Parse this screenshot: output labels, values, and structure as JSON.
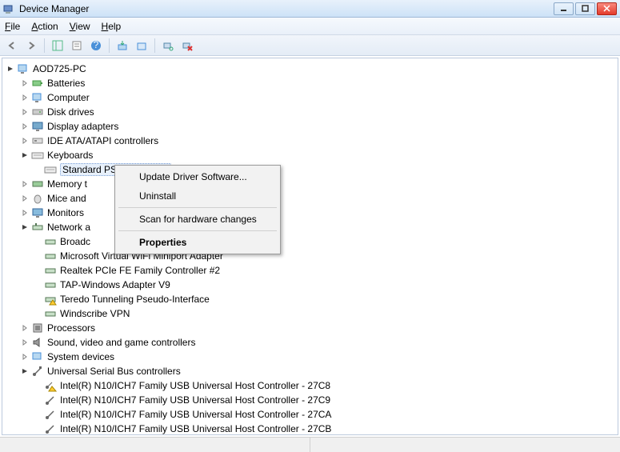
{
  "window": {
    "title": "Device Manager"
  },
  "menus": {
    "file": "File",
    "action": "Action",
    "view": "View",
    "help": "Help"
  },
  "toolbar": {
    "back": "Back",
    "forward": "Forward",
    "show_hide": "Show/Hide Console Tree",
    "properties": "Properties",
    "help": "Help",
    "update": "Update Driver Software",
    "uninstall": "Uninstall",
    "scan": "Scan for hardware changes",
    "remove": "Remove"
  },
  "root": "AOD725-PC",
  "categories": {
    "batteries": "Batteries",
    "computer": "Computer",
    "disk": "Disk drives",
    "display": "Display adapters",
    "ide": "IDE ATA/ATAPI controllers",
    "keyboards": "Keyboards",
    "keyboard_item": "Standard PS/2 Keyboard",
    "memory": "Memory t",
    "mice": "Mice and",
    "monitors": "Monitors",
    "network": "Network a",
    "net_items": [
      "Broadc",
      "Microsoft Virtual WiFi Miniport Adapter",
      "Realtek PCIe FE Family Controller #2",
      "TAP-Windows Adapter V9",
      "Teredo Tunneling Pseudo-Interface",
      "Windscribe VPN"
    ],
    "processors": "Processors",
    "sound": "Sound, video and game controllers",
    "system": "System devices",
    "usb": "Universal Serial Bus controllers",
    "usb_items": [
      "Intel(R) N10/ICH7 Family USB Universal Host Controller - 27C8",
      "Intel(R) N10/ICH7 Family USB Universal Host Controller - 27C9",
      "Intel(R) N10/ICH7 Family USB Universal Host Controller - 27CA",
      "Intel(R) N10/ICH7 Family USB Universal Host Controller - 27CB"
    ]
  },
  "context_menu": {
    "update": "Update Driver Software...",
    "uninstall": "Uninstall",
    "scan": "Scan for hardware changes",
    "properties": "Properties"
  }
}
